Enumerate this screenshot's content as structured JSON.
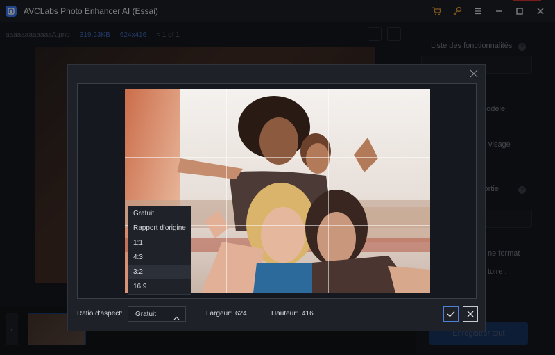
{
  "window": {
    "title": "AVCLabs Photo Enhancer AI (Essai)",
    "icons": [
      "cart-icon",
      "key-icon",
      "menu-icon",
      "minimize-icon",
      "maximize-icon",
      "close-icon"
    ],
    "accent": "#f2a23a"
  },
  "file_bar": {
    "filename": "aaaaaaaaaaaaA.png",
    "size": "319.23KB",
    "dimensions": "624x416",
    "page": "< 1 of 1"
  },
  "right_panel": {
    "features_label": "Liste des fonctionnalités",
    "model_label": "modèle",
    "face_label": "visage",
    "output_label": "sortie",
    "format_label": "ne format",
    "folder_label": "toire :",
    "save_button": "Enregistrer tout"
  },
  "crop_dialog": {
    "ratio_label": "Ratio d'aspect:",
    "ratio_selected": "Gratuit",
    "ratio_options": [
      "Gratuit",
      "Rapport d'origine",
      "1:1",
      "4:3",
      "3:2",
      "16:9"
    ],
    "highlighted_option": "3:2",
    "width_label": "Largeur:",
    "width_value": "624",
    "height_label": "Hauteur:",
    "height_value": "416"
  }
}
